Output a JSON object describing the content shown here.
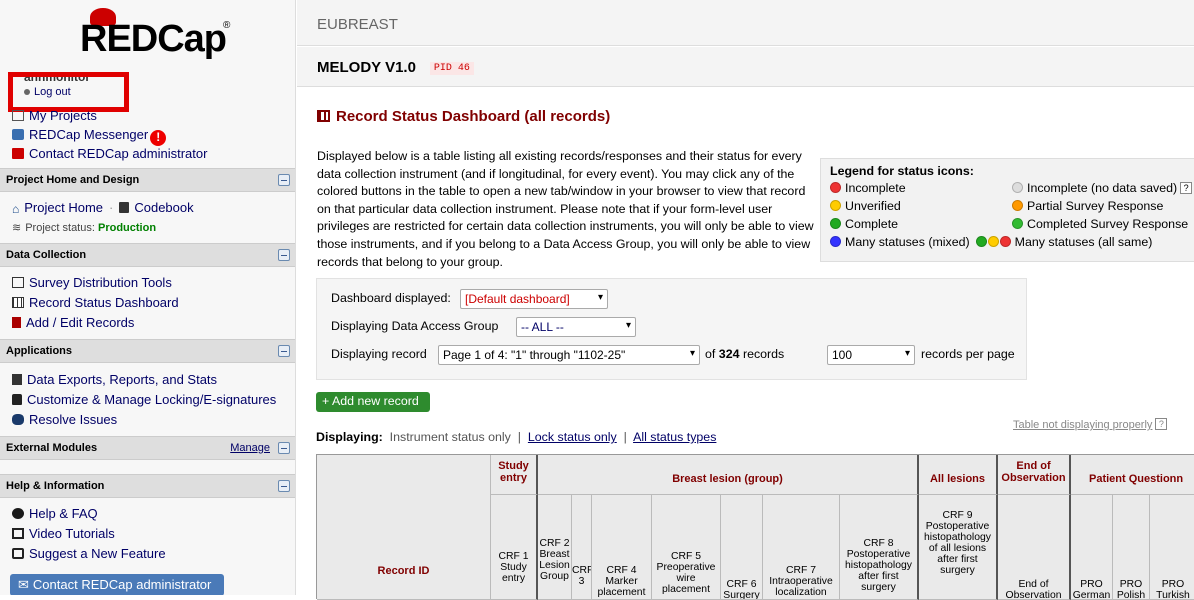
{
  "sidebar": {
    "user_line": "annmonitor",
    "logout": "Log out",
    "my_projects": "My Projects",
    "messenger": "REDCap Messenger",
    "contact_admin": "Contact REDCap administrator",
    "sections": {
      "project_home": "Project Home and Design",
      "data_collection": "Data Collection",
      "applications": "Applications",
      "external_modules": "External Modules",
      "help": "Help & Information"
    },
    "project_home": "Project Home",
    "codebook": "Codebook",
    "project_status_label": "Project status:",
    "project_status_value": "Production",
    "data_collection_links": [
      "Survey Distribution Tools",
      "Record Status Dashboard",
      "Add / Edit Records"
    ],
    "application_links": [
      "Data Exports, Reports, and Stats",
      "Customize & Manage Locking/E-signatures",
      "Resolve Issues"
    ],
    "manage": "Manage",
    "help_links": [
      "Help & FAQ",
      "Video Tutorials",
      "Suggest a New Feature"
    ],
    "contact_button": "Contact REDCap administrator"
  },
  "header": {
    "project_parent": "EUBREAST",
    "project_title": "MELODY V1.0",
    "pid": "PID 46"
  },
  "page": {
    "title": "Record Status Dashboard (all records)",
    "intro": "Displayed below is a table listing all existing records/responses and their status for every data collection instrument (and if longitudinal, for every event). You may click any of the colored buttons in the table to open a new tab/window in your browser to view that record on that particular data collection instrument. Please note that if your form-level user privileges are restricted for certain data collection instruments, you will only be able to view those instruments, and if you belong to a Data Access Group, you will only be able to view records that belong to your group."
  },
  "legend": {
    "title": "Legend for status icons:",
    "incomplete": "Incomplete",
    "incomplete_nodata": "Incomplete (no data saved)",
    "unverified": "Unverified",
    "partial": "Partial Survey Response",
    "complete": "Complete",
    "completed_survey": "Completed Survey Response",
    "many_mixed": "Many statuses (mixed)",
    "many_same": "Many statuses (all same)",
    "help": "?"
  },
  "dashboard": {
    "displayed_label": "Dashboard displayed:",
    "displayed_value": "[Default dashboard]",
    "dag_label": "Displaying Data Access Group",
    "dag_value": "-- ALL --",
    "record_label": "Displaying record",
    "record_value": "Page 1 of 4: \"1\" through \"1102-25\"",
    "of_text": "of",
    "record_count": "324",
    "records_text": "records",
    "per_page_value": "100",
    "per_page_label": "records per page"
  },
  "add_record": "+ Add new record",
  "table_not_displaying": "Table not displaying properly",
  "displaying": {
    "label": "Displaying:",
    "instrument": "Instrument status only",
    "lock": "Lock status only",
    "all": "All status types"
  },
  "table": {
    "record_id": "Record ID",
    "groups": [
      "Study entry",
      "Breast lesion (group)",
      "All lesions",
      "End of Observation",
      "Patient Questionn"
    ],
    "columns": [
      "CRF 1 Study entry",
      "CRF 2 Breast Lesion Group",
      "CRF 3",
      "CRF 4 Marker placement",
      "CRF 5 Preoperative wire placement",
      "CRF 6 Surgery",
      "CRF 7 Intraoperative localization",
      "CRF 8 Postoperative histopathology after first surgery",
      "CRF 9 Postoperative histopathology of all lesions after first surgery",
      "End of Observation",
      "PRO German",
      "PRO Polish",
      "PRO Turkish"
    ]
  },
  "colors": {
    "maroon": "#800000",
    "link": "#000066",
    "highlight": "#e00000"
  }
}
